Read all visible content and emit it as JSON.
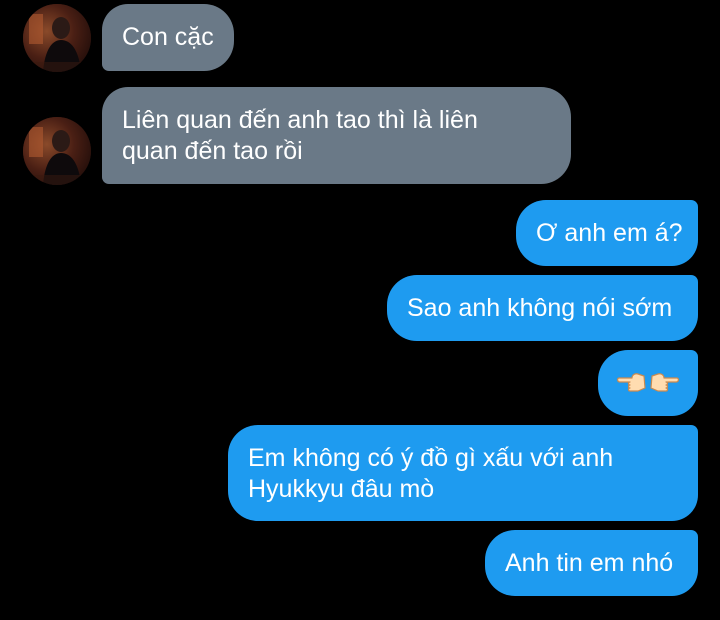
{
  "messages": [
    {
      "sender": "incoming",
      "text": "Con cặc"
    },
    {
      "sender": "incoming",
      "lines": [
        "Liên quan đến anh tao thì là liên",
        "quan đến tao rồi"
      ]
    },
    {
      "sender": "outgoing",
      "text": "Ơ anh em á?"
    },
    {
      "sender": "outgoing",
      "text": "Sao anh không nói sớm"
    },
    {
      "sender": "outgoing",
      "emoji": [
        "point-left-icon",
        "point-right-icon"
      ]
    },
    {
      "sender": "outgoing",
      "lines": [
        "Em không có ý đồ gì xấu với anh",
        "Hyukkyu đâu mò"
      ]
    },
    {
      "sender": "outgoing",
      "text": "Anh tin em nhó"
    }
  ],
  "colors": {
    "background": "#000000",
    "incoming_bubble": "#6a7987",
    "outgoing_bubble": "#1e9bf0",
    "text": "#ffffff"
  }
}
